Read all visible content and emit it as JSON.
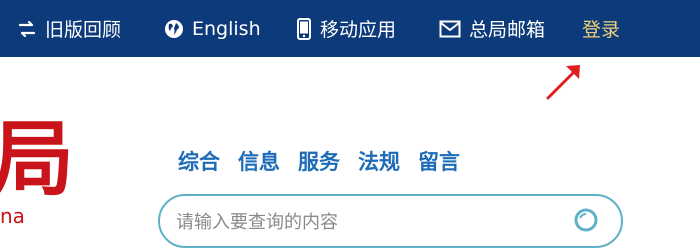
{
  "topbar": {
    "items": [
      {
        "label": "旧版回顾",
        "icon": "swap-icon"
      },
      {
        "label": "English",
        "icon": "globe-icon"
      },
      {
        "label": "移动应用",
        "icon": "mobile-icon"
      },
      {
        "label": "总局邮箱",
        "icon": "mail-icon"
      },
      {
        "label": "登录"
      }
    ],
    "colors": {
      "background": "#0d3a7a",
      "login": "#f0d27a"
    }
  },
  "logo": {
    "char": "局",
    "subtext": "na"
  },
  "search": {
    "tabs": [
      "综合",
      "信息",
      "服务",
      "法规",
      "留言"
    ],
    "placeholder": "请输入要查询的内容",
    "tab_color": "#1e6bb8",
    "border_color": "#5fb1c9"
  }
}
